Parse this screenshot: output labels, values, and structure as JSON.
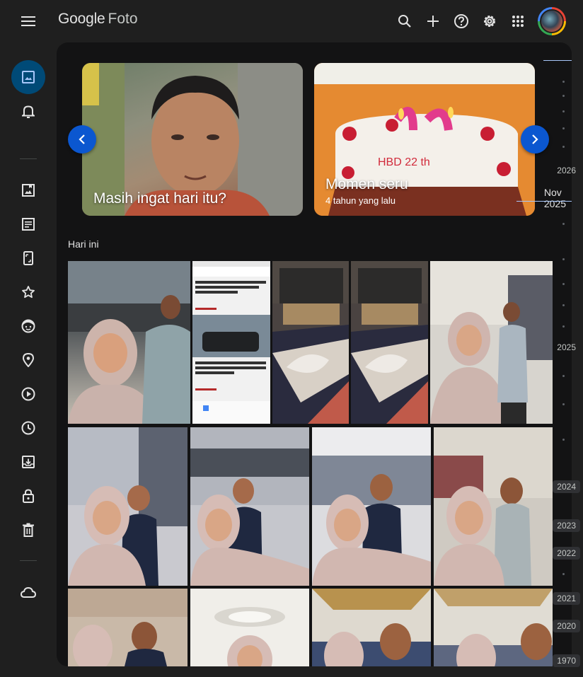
{
  "app": {
    "logo_google": "Google",
    "logo_product": "Foto"
  },
  "memories": [
    {
      "title": "Masih ingat hari itu?",
      "subtitle": ""
    },
    {
      "title": "Momen seru",
      "subtitle": "4 tahun yang lalu"
    }
  ],
  "section": {
    "label": "Hari ini"
  },
  "screenshot_card": {
    "header1": "Kolaborasi dengan Alumni, Pramono Setujui Revitalisasi Halte Kanisius",
    "header2": "Harga Nissan Terra 2.5 VL 2026, Tipe Tertinggi Dengan Mesin Diesel 2.5 Liter"
  },
  "cake_text": "HBD 22 th",
  "scrubber": {
    "current": "Nov 2025",
    "years": [
      "2026",
      "2025",
      "2024",
      "2023",
      "2022",
      "2021",
      "2020",
      "1970"
    ]
  },
  "colors": {
    "background": "#1f1f1f",
    "content_bg": "#131314",
    "accent": "#0b57d0",
    "active_nav": "#004a77"
  },
  "icons": {
    "top": [
      "search-icon",
      "add-icon",
      "help-icon",
      "settings-icon",
      "apps-icon"
    ],
    "sidebar": [
      "photos-icon",
      "updates-icon",
      "albums-icon",
      "documents-icon",
      "screenshots-icon",
      "favorites-icon",
      "people-icon",
      "places-icon",
      "videos-icon",
      "recently-added-icon",
      "archive-icon",
      "locked-folder-icon",
      "trash-icon",
      "storage-cloud-icon"
    ]
  }
}
